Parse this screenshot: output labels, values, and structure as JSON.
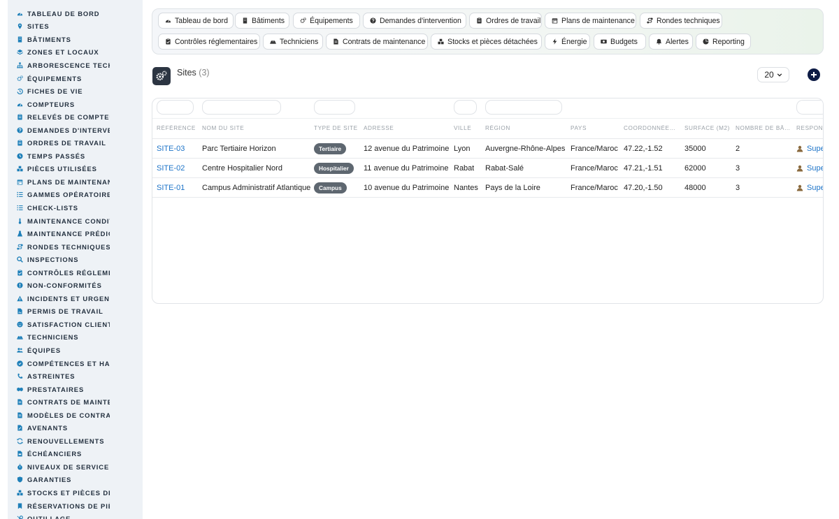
{
  "sidebar": {
    "items": [
      {
        "label": "TABLEAU DE BORD",
        "icon": "dashboard-icon"
      },
      {
        "label": "SITES",
        "icon": "map-pin-icon"
      },
      {
        "label": "BÂTIMENTS",
        "icon": "building-icon"
      },
      {
        "label": "ZONES ET LOCAUX",
        "icon": "layers-icon"
      },
      {
        "label": "ARBORESCENCE TECHNIQUE",
        "icon": "sitemap-icon"
      },
      {
        "label": "ÉQUIPEMENTS",
        "icon": "cogs-icon"
      },
      {
        "label": "FICHES DE VIE",
        "icon": "history-icon"
      },
      {
        "label": "COMPTEURS",
        "icon": "gauge-icon"
      },
      {
        "label": "RELEVÉS DE COMPTEURS",
        "icon": "clipboard-icon"
      },
      {
        "label": "DEMANDES D'INTERVENTION",
        "icon": "question-circle-icon"
      },
      {
        "label": "ORDRES DE TRAVAIL",
        "icon": "clipboard-list-icon"
      },
      {
        "label": "TEMPS PASSÉS",
        "icon": "clock-icon"
      },
      {
        "label": "PIÈCES UTILISÉES",
        "icon": "boxes-icon"
      },
      {
        "label": "PLANS DE MAINTENANCE",
        "icon": "calendar-icon"
      },
      {
        "label": "GAMMES OPÉRATOIRES",
        "icon": "list-ol-icon"
      },
      {
        "label": "CHECK-LISTS",
        "icon": "list-check-icon"
      },
      {
        "label": "MAINTENANCE CONDITIONNELLE",
        "icon": "thermometer-icon"
      },
      {
        "label": "MAINTENANCE PRÉDICTIVE",
        "icon": "flask-icon"
      },
      {
        "label": "RONDES TECHNIQUES",
        "icon": "route-icon"
      },
      {
        "label": "INSPECTIONS",
        "icon": "search-icon"
      },
      {
        "label": "CONTRÔLES RÉGLEMENTAIRES",
        "icon": "clipboard-check-icon"
      },
      {
        "label": "NON-CONFORMITÉS",
        "icon": "exclamation-circle-icon"
      },
      {
        "label": "INCIDENTS ET URGENCES",
        "icon": "warning-triangle-icon"
      },
      {
        "label": "PERMIS DE TRAVAIL",
        "icon": "file-signature-icon"
      },
      {
        "label": "SATISFACTION CLIENT",
        "icon": "smile-icon"
      },
      {
        "label": "TECHNICIENS",
        "icon": "hard-hat-icon"
      },
      {
        "label": "ÉQUIPES",
        "icon": "users-icon"
      },
      {
        "label": "COMPÉTENCES ET HABILITATIONS",
        "icon": "certificate-icon"
      },
      {
        "label": "ASTREINTES",
        "icon": "phone-icon"
      },
      {
        "label": "PRESTATAIRES",
        "icon": "handshake-icon"
      },
      {
        "label": "CONTRATS DE MAINTENANCE",
        "icon": "file-contract-icon"
      },
      {
        "label": "MODÈLES DE CONTRATS",
        "icon": "file-alt-icon"
      },
      {
        "label": "AVENANTS",
        "icon": "file-edit-icon"
      },
      {
        "label": "RENOUVELLEMENTS",
        "icon": "sync-icon"
      },
      {
        "label": "ÉCHÉANCIERS",
        "icon": "file-invoice-icon"
      },
      {
        "label": "NIVEAUX DE SERVICE (SLA)",
        "icon": "stopwatch-icon"
      },
      {
        "label": "GARANTIES",
        "icon": "shield-icon"
      },
      {
        "label": "STOCKS ET PIÈCES DÉTACHÉES",
        "icon": "cubes-icon"
      },
      {
        "label": "RÉSERVATIONS DE PIÈCES",
        "icon": "bookmark-icon"
      },
      {
        "label": "OUTILLAGE",
        "icon": "tools-icon"
      }
    ]
  },
  "topnav": {
    "items": [
      {
        "label": "Tableau de bord",
        "icon": "dashboard-icon"
      },
      {
        "label": "Bâtiments",
        "icon": "building-icon"
      },
      {
        "label": "Équipements",
        "icon": "cogs-icon"
      },
      {
        "label": "Demandes d'intervention",
        "icon": "question-circle-icon"
      },
      {
        "label": "Ordres de travail",
        "icon": "clipboard-list-icon"
      },
      {
        "label": "Plans de maintenance",
        "icon": "calendar-icon"
      },
      {
        "label": "Rondes techniques",
        "icon": "route-icon"
      },
      {
        "label": "Contrôles réglementaires",
        "icon": "clipboard-check-icon"
      },
      {
        "label": "Techniciens",
        "icon": "hard-hat-icon"
      },
      {
        "label": "Contrats de maintenance",
        "icon": "file-contract-icon"
      },
      {
        "label": "Stocks et pièces détachées",
        "icon": "cubes-icon"
      },
      {
        "label": "Énergie",
        "icon": "bolt-icon"
      },
      {
        "label": "Budgets",
        "icon": "money-icon"
      },
      {
        "label": "Alertes",
        "icon": "bell-icon"
      },
      {
        "label": "Reporting",
        "icon": "pie-chart-icon"
      }
    ]
  },
  "page": {
    "title": "Sites",
    "count": "(3)",
    "logo_icon": "cogs-icon",
    "per_page": "20",
    "add_icon": "plus-circle-icon"
  },
  "table": {
    "columns": [
      "RÉFÉRENCE",
      "NOM DU SITE",
      "TYPE DE SITE",
      "ADRESSE",
      "VILLE",
      "RÉGION",
      "PAYS",
      "COORDONNÉE…",
      "SURFACE (M2)",
      "NOMBRE DE BÂ…",
      "RESPONS"
    ],
    "rows": [
      {
        "ref": "SITE-03",
        "name": "Parc Tertiaire Horizon",
        "type": "Tertiaire",
        "address": "12 avenue du Patrimoine",
        "city": "Lyon",
        "region": "Auvergne-Rhône-Alpes",
        "country": "France/Maroc",
        "coords": "47.22,-1.52",
        "surface": "35000",
        "buildings": "2",
        "manager": "Supe"
      },
      {
        "ref": "SITE-02",
        "name": "Centre Hospitalier Nord",
        "type": "Hospitalier",
        "address": "11 avenue du Patrimoine",
        "city": "Rabat",
        "region": "Rabat-Salé",
        "country": "France/Maroc",
        "coords": "47.21,-1.51",
        "surface": "62000",
        "buildings": "3",
        "manager": "Supe"
      },
      {
        "ref": "SITE-01",
        "name": "Campus Administratif Atlantique",
        "type": "Campus",
        "address": "10 avenue du Patrimoine",
        "city": "Nantes",
        "region": "Pays de la Loire",
        "country": "France/Maroc",
        "coords": "47.20,-1.50",
        "surface": "48000",
        "buildings": "3",
        "manager": "Supe"
      }
    ]
  },
  "colors": {
    "link": "#1e74c8",
    "badge": "#5e6770",
    "sidebar_icon": "#1e7fb8",
    "add_button": "#0d1b45"
  }
}
